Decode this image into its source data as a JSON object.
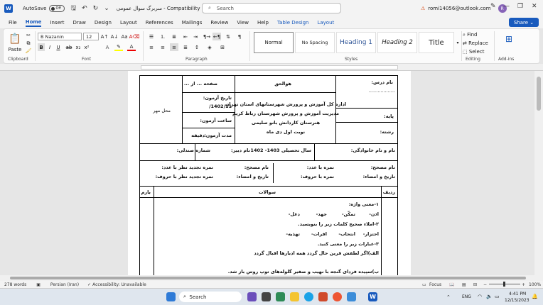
{
  "titlebar": {
    "app_letter": "W",
    "autosave_label": "AutoSave",
    "autosave_state": "Off",
    "doc_title": "سربرگ سوال عمومی - Compatibility Mode ⌄",
    "search_placeholder": "Search",
    "account_email": "romi14056@outlook.com",
    "avatar_initial": "R"
  },
  "menu": [
    "File",
    "Home",
    "Insert",
    "Draw",
    "Design",
    "Layout",
    "References",
    "Mailings",
    "Review",
    "View",
    "Help",
    "Table Design",
    "Layout"
  ],
  "share_label": "Share",
  "ribbon": {
    "clipboard": {
      "paste": "Paste",
      "label": "Clipboard"
    },
    "font": {
      "name": "B Nazanin",
      "size": "12",
      "label": "Font"
    },
    "paragraph": {
      "label": "Paragraph"
    },
    "styles": {
      "items": [
        "Normal",
        "No Spacing",
        "Heading 1",
        "Heading 2",
        "Title"
      ],
      "label": "Styles"
    },
    "editing": {
      "find": "Find",
      "replace": "Replace",
      "select": "Select",
      "label": "Editing"
    },
    "addins": {
      "label": "Add-ins"
    }
  },
  "document": {
    "page_no": "صفحه ... از ...",
    "hovalhagh": "هوالحق",
    "lesson_name": "نام درس:",
    "lesson_dashes": "..................",
    "exam_date_label": "تاریخ آزمون:",
    "exam_date_value": "1402/11/",
    "exam_time": "ساعت آزمون:",
    "duration_label": "مدت آزمون:",
    "duration_unit": "دقیقه",
    "seal": "محل مهر",
    "org1": "اداره کل آموزش و پرورش شهرستانهای استان تهران",
    "org2": "مدیریت آموزش و پرورش شهرستان رباط کریم",
    "org3": "هنرستان کاردانش بانو سلیمی",
    "org4": "نوبت اول دی ماه",
    "grade": "پایه:",
    "field": "رشته:",
    "student_name": "نام و نام خانوادگی:",
    "school_year": "سال تحصیلی 1403- 1402",
    "teacher": "نام دبیر:",
    "seat_number": "شماره صندلی:",
    "corrector_name1": "نام مصحح:",
    "score_digits": "نمره با عدد:",
    "date_sign1": "تاریخ و امضاء:",
    "score_letters": "نمره با حروف:",
    "corrector_name2": "نام مصحح:",
    "review_digits": "نمره تجدید نظر با عدد:",
    "date_sign2": "تاریخ و امضاء:",
    "review_letters": "نمره تجدید نظر با حروف:",
    "col_row": "ردیف",
    "col_questions": "سوالات",
    "col_score": "بارم",
    "q1": "۱-معنی واژه:",
    "q1_words": [
      "اذن-",
      "تمکّن-",
      "جهد-",
      "دغل-"
    ],
    "q2": "۲-املاء صحیح کلمات زیر را بنویسید.",
    "q2_words": [
      "احتزار-",
      "انتحاب-",
      "افرات-",
      "تهذیه-"
    ],
    "q3": "۳-عبارات زیر را معنی کنید.",
    "q3a": "الف)اگر لطفش قرین حال گردد    همه ادبارها اقبال گردد",
    "q3b": "ب)سپیده فردای گنجه با نهیب و صفیر گلوله‌های توپ روس باز شد."
  },
  "status": {
    "words": "278 words",
    "language": "Persian (Iran)",
    "accessibility": "Accessibility: Unavailable",
    "focus": "Focus",
    "zoom": "100%"
  },
  "taskbar": {
    "search": "Search",
    "time": "4:41 PM",
    "date": "12/15/2023",
    "lang": "ENG"
  }
}
